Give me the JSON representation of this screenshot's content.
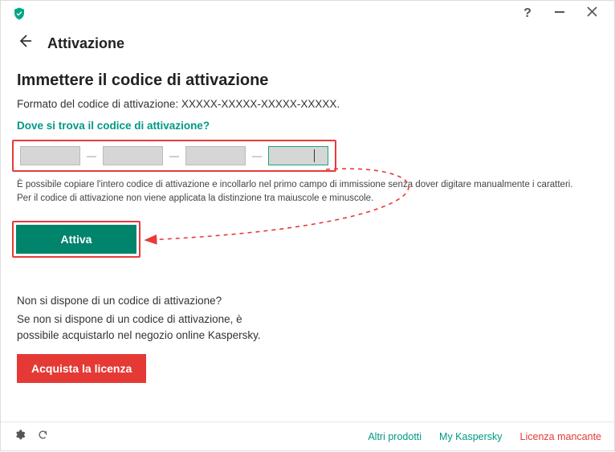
{
  "header": {
    "title": "Attivazione"
  },
  "main": {
    "section_title": "Immettere il codice di attivazione",
    "format_text": "Formato del codice di attivazione: XXXXX-XXXXX-XXXXX-XXXXX.",
    "where_link": "Dove si trova il codice di attivazione?",
    "help_line1": "È possibile copiare l'intero codice di attivazione e incollarlo nel primo campo di immissione senza dover digitare manualmente i caratteri.",
    "help_line2": "Per il codice di attivazione non viene applicata la distinzione tra maiuscole e minuscole.",
    "activate_label": "Attiva",
    "no_code_title": "Non si dispone di un codice di attivazione?",
    "no_code_text": "Se non si dispone di un codice di attivazione, è possibile acquistarlo nel negozio online Kaspersky.",
    "buy_label": "Acquista la licenza"
  },
  "footer": {
    "link1": "Altri prodotti",
    "link2": "My Kaspersky",
    "link3": "Licenza mancante"
  },
  "code_fields": {
    "v1": "",
    "v2": "",
    "v3": "",
    "v4": ""
  }
}
